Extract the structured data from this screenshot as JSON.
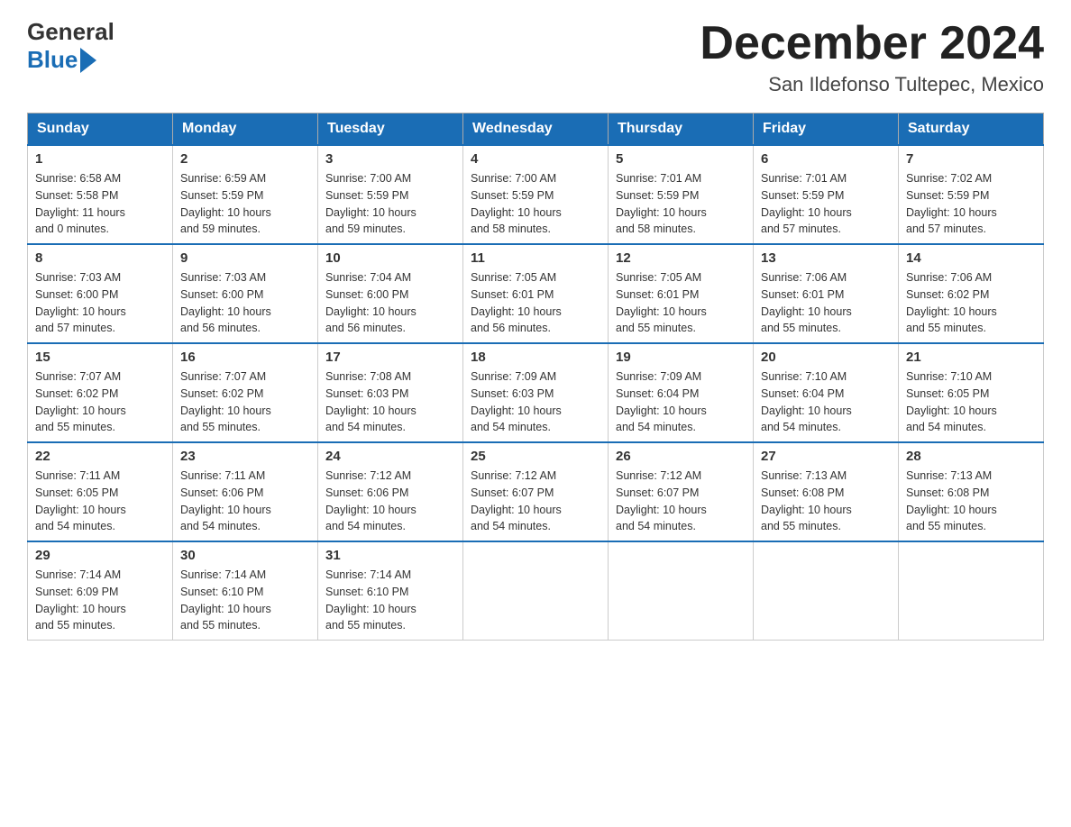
{
  "header": {
    "logo_general": "General",
    "logo_blue": "Blue",
    "month_title": "December 2024",
    "location": "San Ildefonso Tultepec, Mexico"
  },
  "days_of_week": [
    "Sunday",
    "Monday",
    "Tuesday",
    "Wednesday",
    "Thursday",
    "Friday",
    "Saturday"
  ],
  "weeks": [
    [
      {
        "day": "1",
        "sunrise": "6:58 AM",
        "sunset": "5:58 PM",
        "daylight": "11 hours and 0 minutes."
      },
      {
        "day": "2",
        "sunrise": "6:59 AM",
        "sunset": "5:59 PM",
        "daylight": "10 hours and 59 minutes."
      },
      {
        "day": "3",
        "sunrise": "7:00 AM",
        "sunset": "5:59 PM",
        "daylight": "10 hours and 59 minutes."
      },
      {
        "day": "4",
        "sunrise": "7:00 AM",
        "sunset": "5:59 PM",
        "daylight": "10 hours and 58 minutes."
      },
      {
        "day": "5",
        "sunrise": "7:01 AM",
        "sunset": "5:59 PM",
        "daylight": "10 hours and 58 minutes."
      },
      {
        "day": "6",
        "sunrise": "7:01 AM",
        "sunset": "5:59 PM",
        "daylight": "10 hours and 57 minutes."
      },
      {
        "day": "7",
        "sunrise": "7:02 AM",
        "sunset": "5:59 PM",
        "daylight": "10 hours and 57 minutes."
      }
    ],
    [
      {
        "day": "8",
        "sunrise": "7:03 AM",
        "sunset": "6:00 PM",
        "daylight": "10 hours and 57 minutes."
      },
      {
        "day": "9",
        "sunrise": "7:03 AM",
        "sunset": "6:00 PM",
        "daylight": "10 hours and 56 minutes."
      },
      {
        "day": "10",
        "sunrise": "7:04 AM",
        "sunset": "6:00 PM",
        "daylight": "10 hours and 56 minutes."
      },
      {
        "day": "11",
        "sunrise": "7:05 AM",
        "sunset": "6:01 PM",
        "daylight": "10 hours and 56 minutes."
      },
      {
        "day": "12",
        "sunrise": "7:05 AM",
        "sunset": "6:01 PM",
        "daylight": "10 hours and 55 minutes."
      },
      {
        "day": "13",
        "sunrise": "7:06 AM",
        "sunset": "6:01 PM",
        "daylight": "10 hours and 55 minutes."
      },
      {
        "day": "14",
        "sunrise": "7:06 AM",
        "sunset": "6:02 PM",
        "daylight": "10 hours and 55 minutes."
      }
    ],
    [
      {
        "day": "15",
        "sunrise": "7:07 AM",
        "sunset": "6:02 PM",
        "daylight": "10 hours and 55 minutes."
      },
      {
        "day": "16",
        "sunrise": "7:07 AM",
        "sunset": "6:02 PM",
        "daylight": "10 hours and 55 minutes."
      },
      {
        "day": "17",
        "sunrise": "7:08 AM",
        "sunset": "6:03 PM",
        "daylight": "10 hours and 54 minutes."
      },
      {
        "day": "18",
        "sunrise": "7:09 AM",
        "sunset": "6:03 PM",
        "daylight": "10 hours and 54 minutes."
      },
      {
        "day": "19",
        "sunrise": "7:09 AM",
        "sunset": "6:04 PM",
        "daylight": "10 hours and 54 minutes."
      },
      {
        "day": "20",
        "sunrise": "7:10 AM",
        "sunset": "6:04 PM",
        "daylight": "10 hours and 54 minutes."
      },
      {
        "day": "21",
        "sunrise": "7:10 AM",
        "sunset": "6:05 PM",
        "daylight": "10 hours and 54 minutes."
      }
    ],
    [
      {
        "day": "22",
        "sunrise": "7:11 AM",
        "sunset": "6:05 PM",
        "daylight": "10 hours and 54 minutes."
      },
      {
        "day": "23",
        "sunrise": "7:11 AM",
        "sunset": "6:06 PM",
        "daylight": "10 hours and 54 minutes."
      },
      {
        "day": "24",
        "sunrise": "7:12 AM",
        "sunset": "6:06 PM",
        "daylight": "10 hours and 54 minutes."
      },
      {
        "day": "25",
        "sunrise": "7:12 AM",
        "sunset": "6:07 PM",
        "daylight": "10 hours and 54 minutes."
      },
      {
        "day": "26",
        "sunrise": "7:12 AM",
        "sunset": "6:07 PM",
        "daylight": "10 hours and 54 minutes."
      },
      {
        "day": "27",
        "sunrise": "7:13 AM",
        "sunset": "6:08 PM",
        "daylight": "10 hours and 55 minutes."
      },
      {
        "day": "28",
        "sunrise": "7:13 AM",
        "sunset": "6:08 PM",
        "daylight": "10 hours and 55 minutes."
      }
    ],
    [
      {
        "day": "29",
        "sunrise": "7:14 AM",
        "sunset": "6:09 PM",
        "daylight": "10 hours and 55 minutes."
      },
      {
        "day": "30",
        "sunrise": "7:14 AM",
        "sunset": "6:10 PM",
        "daylight": "10 hours and 55 minutes."
      },
      {
        "day": "31",
        "sunrise": "7:14 AM",
        "sunset": "6:10 PM",
        "daylight": "10 hours and 55 minutes."
      },
      null,
      null,
      null,
      null
    ]
  ],
  "labels": {
    "sunrise": "Sunrise:",
    "sunset": "Sunset:",
    "daylight": "Daylight:"
  }
}
